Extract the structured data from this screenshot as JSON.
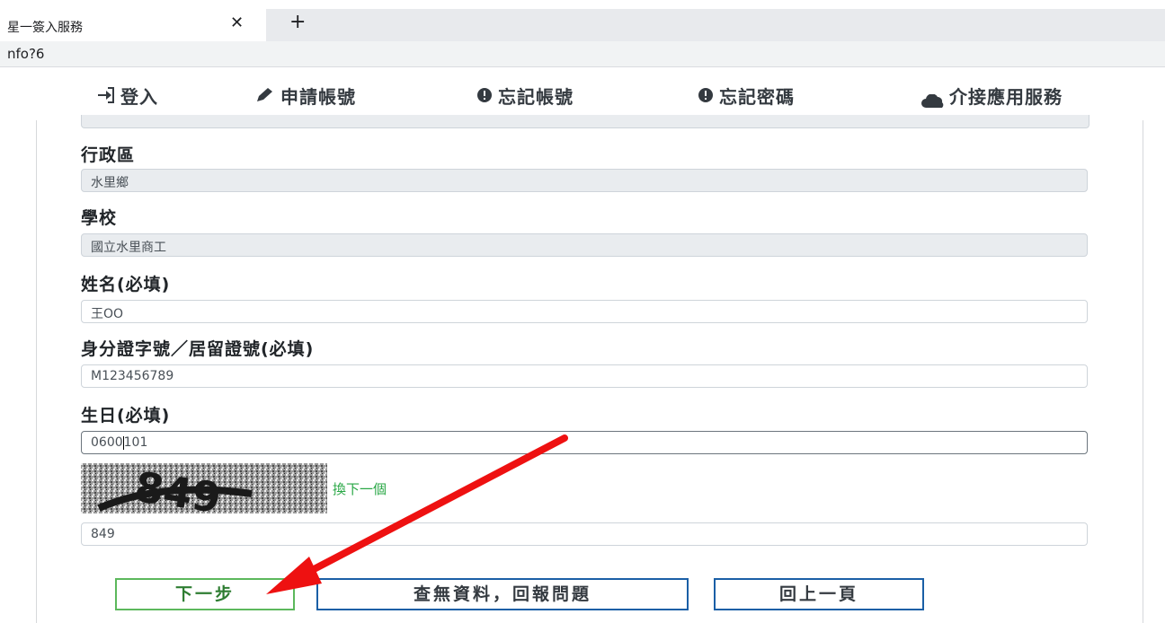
{
  "browser": {
    "tab_title": "星一簽入服務",
    "close_glyph": "✕",
    "new_tab_glyph": "+",
    "url": "nfo?6"
  },
  "nav": {
    "items": [
      {
        "label": "登入",
        "icon": "sign-in-icon"
      },
      {
        "label": "申請帳號",
        "icon": "pencil-icon"
      },
      {
        "label": "忘記帳號",
        "icon": "exclamation-icon"
      },
      {
        "label": "忘記密碼",
        "icon": "exclamation-icon"
      },
      {
        "label": "介接應用服務",
        "icon": "cloud-icon"
      }
    ]
  },
  "form": {
    "district_label": "行政區",
    "district_value": "水里鄉",
    "school_label": "學校",
    "school_value": "國立水里商工",
    "name_label": "姓名(必填)",
    "name_value": "王OO",
    "id_label": "身分證字號／居留證號(必填)",
    "id_value": "M123456789",
    "birthday_label": "生日(必填)",
    "birthday_value_before_caret": "0600",
    "birthday_value_after_caret": "101",
    "captcha_text": "849",
    "captcha_refresh_label": "換下一個",
    "captcha_input_value": "849"
  },
  "buttons": {
    "next": "下一步",
    "report": "查無資料，回報問題",
    "back": "回上一頁"
  },
  "colors": {
    "annotation_arrow": "#ee1111",
    "next_border": "#5cb85c",
    "primary_border": "#1a5fa6",
    "link": "#28a745"
  }
}
